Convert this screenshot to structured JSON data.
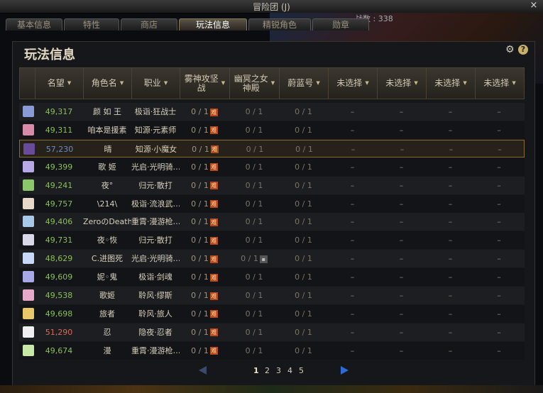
{
  "window": {
    "title": "冒险团 (J)",
    "close": "×"
  },
  "tabs": [
    {
      "label": "基本信息",
      "active": false
    },
    {
      "label": "特性",
      "active": false
    },
    {
      "label": "商店",
      "active": false
    },
    {
      "label": "玩法信息",
      "active": true
    },
    {
      "label": "精锐角色",
      "active": false
    },
    {
      "label": "勋章",
      "active": false
    }
  ],
  "stat_text": "战数 : 338",
  "panel": {
    "title": "玩法信息",
    "help": "?"
  },
  "columns": [
    {
      "label": "名望",
      "sortable": true
    },
    {
      "label": "角色名",
      "sortable": true
    },
    {
      "label": "职业",
      "sortable": true
    },
    {
      "label": "雾神攻坚战",
      "sortable": true
    },
    {
      "label": "幽冥之女神殿",
      "sortable": true
    },
    {
      "label": "蔚蓝号",
      "sortable": true
    },
    {
      "label": "未选择",
      "sortable": true
    },
    {
      "label": "未选择",
      "sortable": true
    },
    {
      "label": "未选择",
      "sortable": true
    },
    {
      "label": "未选择",
      "sortable": true
    }
  ],
  "badge_text": "难",
  "rows": [
    {
      "fame": "49,317",
      "name": "颜 如 王",
      "job": "极诣·狂战士",
      "c1": "0 / 1",
      "c2": "0 / 1",
      "c3": "0 / 1",
      "dash": "–",
      "fame_color": "green",
      "avatar": "#8a9ad8"
    },
    {
      "fame": "49,311",
      "name": "咱本是援素",
      "job": "知源·元素师",
      "c1": "0 / 1",
      "c2": "0 / 1",
      "c3": "0 / 1",
      "dash": "–",
      "fame_color": "green",
      "avatar": "#d88aa8"
    },
    {
      "fame": "57,230",
      "name": "晴",
      "job": "知源·小魔女",
      "c1": "0 / 1",
      "c2": "0 / 1",
      "c3": "0 / 1",
      "dash": "–",
      "fame_color": "blue",
      "avatar": "#6a4a9a"
    },
    {
      "fame": "49,399",
      "name": "歌 姬",
      "job": "光启·光明骑…",
      "c1": "0 / 1",
      "c2": "0 / 1",
      "c3": "0 / 1",
      "dash": "–",
      "fame_color": "green",
      "avatar": "#b8a8e8"
    },
    {
      "fame": "49,241",
      "name": "夜°",
      "job": "归元·散打",
      "c1": "0 / 1",
      "c2": "0 / 1",
      "c3": "0 / 1",
      "dash": "–",
      "fame_color": "green",
      "avatar": "#8ac86a"
    },
    {
      "fame": "49,757",
      "name": "\\214\\",
      "job": "极诣·流浪武…",
      "c1": "0 / 1",
      "c2": "0 / 1",
      "c3": "0 / 1",
      "dash": "–",
      "fame_color": "green",
      "avatar": "#e8d8c8"
    },
    {
      "fame": "49,406",
      "name": "ZeroのDeath",
      "job": "重霄·漫游枪…",
      "c1": "0 / 1",
      "c2": "0 / 1",
      "c3": "0 / 1",
      "dash": "–",
      "fame_color": "green",
      "avatar": "#a8c8e8"
    },
    {
      "fame": "49,731",
      "name": "夜◦恢",
      "job": "归元·散打",
      "c1": "0 / 1",
      "c2": "0 / 1",
      "c3": "0 / 1",
      "dash": "–",
      "fame_color": "green",
      "avatar": "#d8d8e8"
    },
    {
      "fame": "48,629",
      "name": "C.进图死",
      "job": "光启·光明骑…",
      "c1": "0 / 1",
      "c2": "0 / 1",
      "c3": "0 / 1",
      "dash": "–",
      "fame_color": "green",
      "avatar": "#c8d8f8",
      "c2_lock": true
    },
    {
      "fame": "49,609",
      "name": "妮◦鬼",
      "job": "极诣·剑魂",
      "c1": "0 / 1",
      "c2": "0 / 1",
      "c3": "0 / 1",
      "dash": "–",
      "fame_color": "green",
      "avatar": "#a8a8e8"
    },
    {
      "fame": "49,538",
      "name": "歌姬",
      "job": "聆风·缪斯",
      "c1": "0 / 1",
      "c2": "0 / 1",
      "c3": "0 / 1",
      "dash": "–",
      "fame_color": "green",
      "avatar": "#e8a8c8"
    },
    {
      "fame": "49,698",
      "name": "旅者",
      "job": "聆风·旅人",
      "c1": "0 / 1",
      "c2": "0 / 1",
      "c3": "0 / 1",
      "dash": "–",
      "fame_color": "green",
      "avatar": "#e8c868"
    },
    {
      "fame": "51,290",
      "name": "忍",
      "job": "隐夜·忍者",
      "c1": "0 / 1",
      "c2": "0 / 1",
      "c3": "0 / 1",
      "dash": "–",
      "fame_color": "red",
      "avatar": "#f0f0f0"
    },
    {
      "fame": "49,674",
      "name": "漫",
      "job": "重霄·漫游枪…",
      "c1": "0 / 1",
      "c2": "0 / 1",
      "c3": "0 / 1",
      "dash": "–",
      "fame_color": "green",
      "avatar": "#c8e8a8"
    }
  ],
  "pagination": {
    "pages": [
      "1",
      "2",
      "3",
      "4",
      "5"
    ],
    "current": "1"
  },
  "colors": {
    "accent": "#c9b069",
    "fame_green": "#8dbd5c",
    "fame_blue": "#6d88c8",
    "fame_red": "#d66a5a",
    "badge": "#b54a1e",
    "next_arrow": "#2f6ad6"
  }
}
